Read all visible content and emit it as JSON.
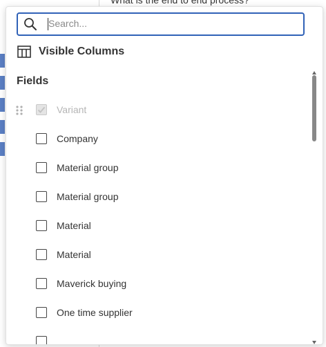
{
  "background": {
    "question_text": "What is the end to end process?"
  },
  "search": {
    "placeholder": "Search...",
    "value": ""
  },
  "columns_panel": {
    "title": "Visible Columns",
    "icon": "table-columns-icon"
  },
  "fields": {
    "heading": "Fields",
    "items": [
      {
        "label": "Variant",
        "checked": true,
        "disabled": true
      },
      {
        "label": "Company",
        "checked": false,
        "disabled": false
      },
      {
        "label": "Material group",
        "checked": false,
        "disabled": false
      },
      {
        "label": "Material group",
        "checked": false,
        "disabled": false
      },
      {
        "label": "Material",
        "checked": false,
        "disabled": false
      },
      {
        "label": "Material",
        "checked": false,
        "disabled": false
      },
      {
        "label": "Maverick buying",
        "checked": false,
        "disabled": false
      },
      {
        "label": "One time supplier",
        "checked": false,
        "disabled": false
      }
    ]
  },
  "colors": {
    "accent": "#2f61b7",
    "side_marker": "#5b7fc4",
    "scroll_thumb": "#888888"
  }
}
